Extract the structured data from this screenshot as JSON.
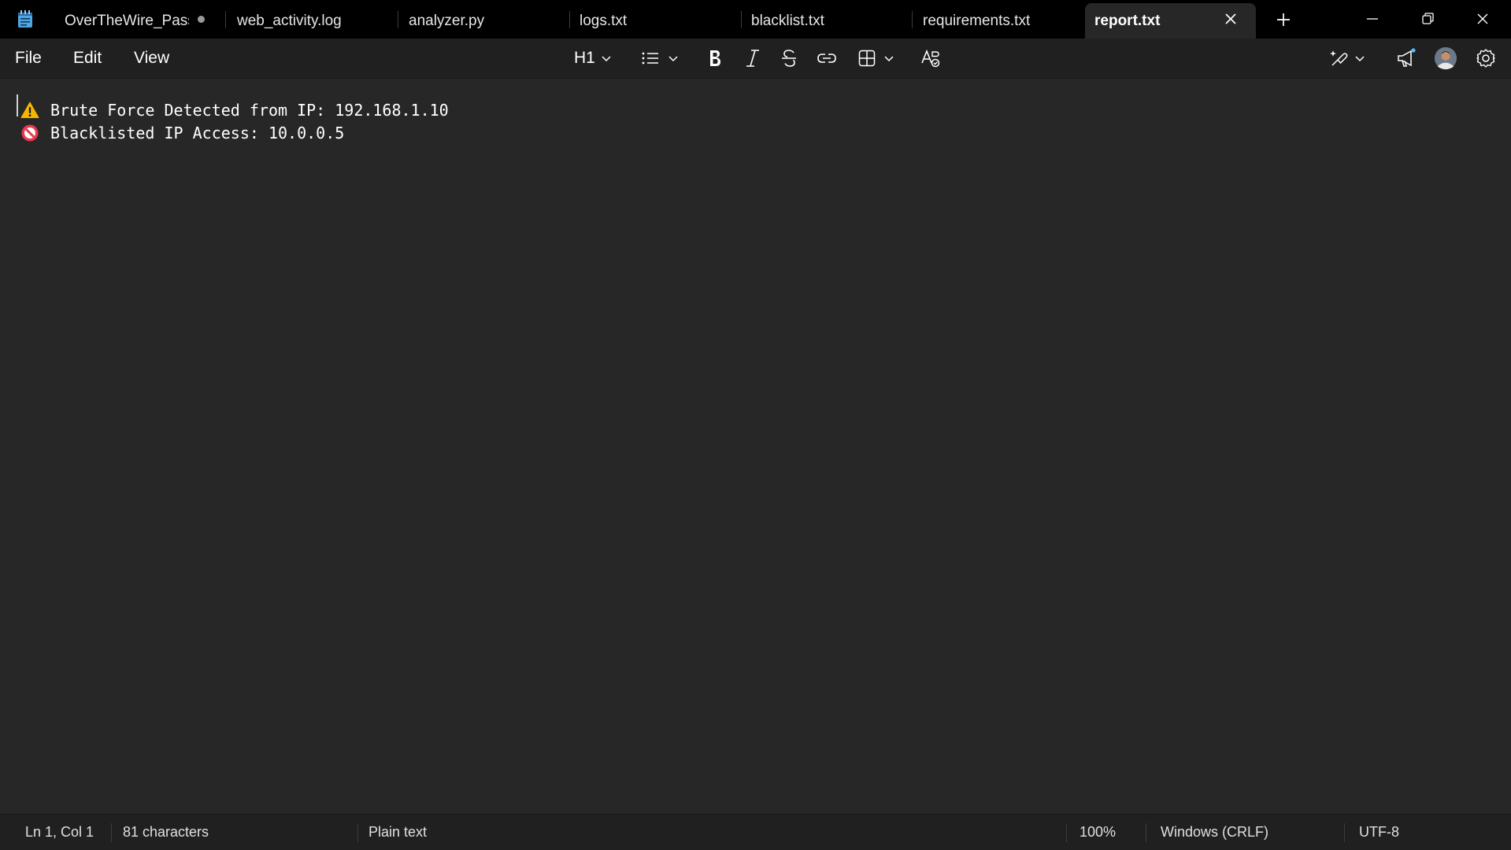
{
  "tabs": [
    {
      "label": "OverTheWire_Pass",
      "modified": true
    },
    {
      "label": "web_activity.log"
    },
    {
      "label": "analyzer.py"
    },
    {
      "label": "logs.txt"
    },
    {
      "label": "blacklist.txt"
    },
    {
      "label": "requirements.txt"
    },
    {
      "label": "report.txt",
      "active": true
    }
  ],
  "menu": {
    "file": "File",
    "edit": "Edit",
    "view": "View"
  },
  "toolbar": {
    "heading": "H1",
    "icons": [
      "list-icon",
      "bold-icon",
      "italic-icon",
      "strikethrough-icon",
      "link-icon",
      "table-icon",
      "spellcheck-icon",
      "copilot-icon",
      "megaphone-icon",
      "avatar",
      "gear-icon"
    ]
  },
  "editor": {
    "lines": [
      {
        "icon": "warning-icon",
        "text": "Brute Force Detected from IP: 192.168.1.10"
      },
      {
        "icon": "prohibited-icon",
        "text": "Blacklisted IP Access: 10.0.0.5"
      }
    ]
  },
  "status": {
    "position": "Ln 1, Col 1",
    "characters": "81 characters",
    "format": "Plain text",
    "zoom": "100%",
    "line_ending": "Windows (CRLF)",
    "encoding": "UTF-8"
  },
  "colors": {
    "titlebar": "#000000",
    "editor_bg": "#272727",
    "toolbar_bg": "#202020",
    "accent": "#4cc2ff",
    "warning": "#f7b500",
    "prohibited": "#e8384f"
  }
}
